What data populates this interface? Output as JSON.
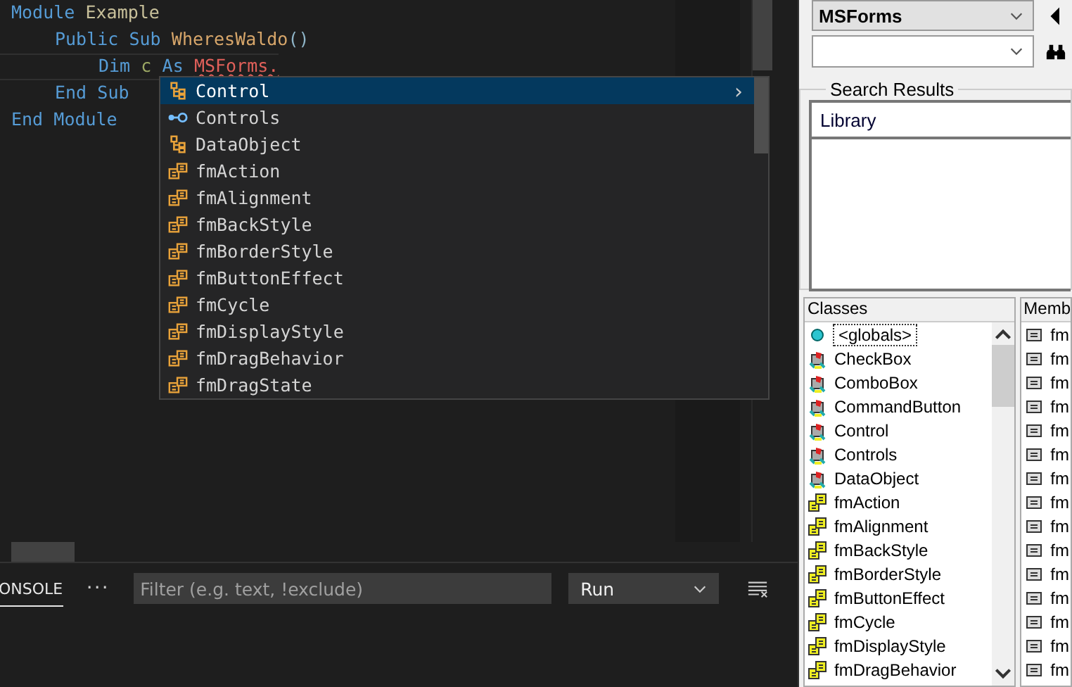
{
  "editor": {
    "code": [
      {
        "tokens": [
          {
            "text": "Module",
            "kind": "keyword"
          },
          {
            "text": "Example",
            "kind": "name"
          }
        ],
        "children": [
          {
            "tokens": [
              {
                "text": "Public",
                "kind": "keyword"
              },
              {
                "text": "Sub",
                "kind": "keyword"
              },
              {
                "text": "WheresWaldo",
                "kind": "function"
              },
              {
                "text": "()",
                "kind": "punct",
                "joined": true
              }
            ],
            "children": [
              {
                "tokens": [
                  {
                    "text": "Dim",
                    "kind": "keyword"
                  },
                  {
                    "text": "c",
                    "kind": "variable"
                  },
                  {
                    "text": "As",
                    "kind": "keyword"
                  },
                  {
                    "text": "MSForms.",
                    "kind": "error"
                  }
                ],
                "current": true
              }
            ]
          },
          {
            "tokens": [
              {
                "text": "End",
                "kind": "keyword"
              },
              {
                "text": "Sub",
                "kind": "keyword"
              }
            ]
          }
        ]
      },
      {
        "tokens": [
          {
            "text": "End",
            "kind": "keyword"
          },
          {
            "text": "Module",
            "kind": "keyword"
          }
        ]
      }
    ],
    "completions": [
      {
        "label": "Control",
        "kind": "class",
        "selected": true,
        "chevron": "›"
      },
      {
        "label": "Controls",
        "kind": "interface",
        "selected": false
      },
      {
        "label": "DataObject",
        "kind": "class",
        "selected": false
      },
      {
        "label": "fmAction",
        "kind": "enum",
        "selected": false
      },
      {
        "label": "fmAlignment",
        "kind": "enum",
        "selected": false
      },
      {
        "label": "fmBackStyle",
        "kind": "enum",
        "selected": false
      },
      {
        "label": "fmBorderStyle",
        "kind": "enum",
        "selected": false
      },
      {
        "label": "fmButtonEffect",
        "kind": "enum",
        "selected": false
      },
      {
        "label": "fmCycle",
        "kind": "enum",
        "selected": false
      },
      {
        "label": "fmDisplayStyle",
        "kind": "enum",
        "selected": false
      },
      {
        "label": "fmDragBehavior",
        "kind": "enum",
        "selected": false
      },
      {
        "label": "fmDragState",
        "kind": "enum",
        "selected": false
      }
    ]
  },
  "panel": {
    "tabs": [
      {
        "label": "ONSOLE",
        "selected": true
      }
    ],
    "more": "···",
    "filter": {
      "placeholder": "Filter (e.g. text, !exclude)"
    },
    "run_select": {
      "value": "Run"
    }
  },
  "object_browser": {
    "library_select": {
      "value": "MSForms"
    },
    "search_results": {
      "title": "Search Results",
      "columns": [
        "Library"
      ]
    },
    "classes": {
      "title": "Classes",
      "items": [
        {
          "label": "<globals>",
          "kind": "globals",
          "selected": true
        },
        {
          "label": "CheckBox",
          "kind": "class",
          "selected": false
        },
        {
          "label": "ComboBox",
          "kind": "class",
          "selected": false
        },
        {
          "label": "CommandButton",
          "kind": "class",
          "selected": false
        },
        {
          "label": "Control",
          "kind": "class",
          "selected": false
        },
        {
          "label": "Controls",
          "kind": "class",
          "selected": false
        },
        {
          "label": "DataObject",
          "kind": "class",
          "selected": false
        },
        {
          "label": "fmAction",
          "kind": "enum",
          "selected": false
        },
        {
          "label": "fmAlignment",
          "kind": "enum",
          "selected": false
        },
        {
          "label": "fmBackStyle",
          "kind": "enum",
          "selected": false
        },
        {
          "label": "fmBorderStyle",
          "kind": "enum",
          "selected": false
        },
        {
          "label": "fmButtonEffect",
          "kind": "enum",
          "selected": false
        },
        {
          "label": "fmCycle",
          "kind": "enum",
          "selected": false
        },
        {
          "label": "fmDisplayStyle",
          "kind": "enum",
          "selected": false
        },
        {
          "label": "fmDragBehavior",
          "kind": "enum",
          "selected": false
        }
      ]
    },
    "members": {
      "title": "Memb",
      "items": [
        "fm",
        "fm",
        "fm",
        "fm",
        "fm",
        "fm",
        "fm",
        "fm",
        "fm",
        "fm",
        "fm",
        "fm",
        "fm",
        "fm",
        "fm"
      ]
    }
  }
}
